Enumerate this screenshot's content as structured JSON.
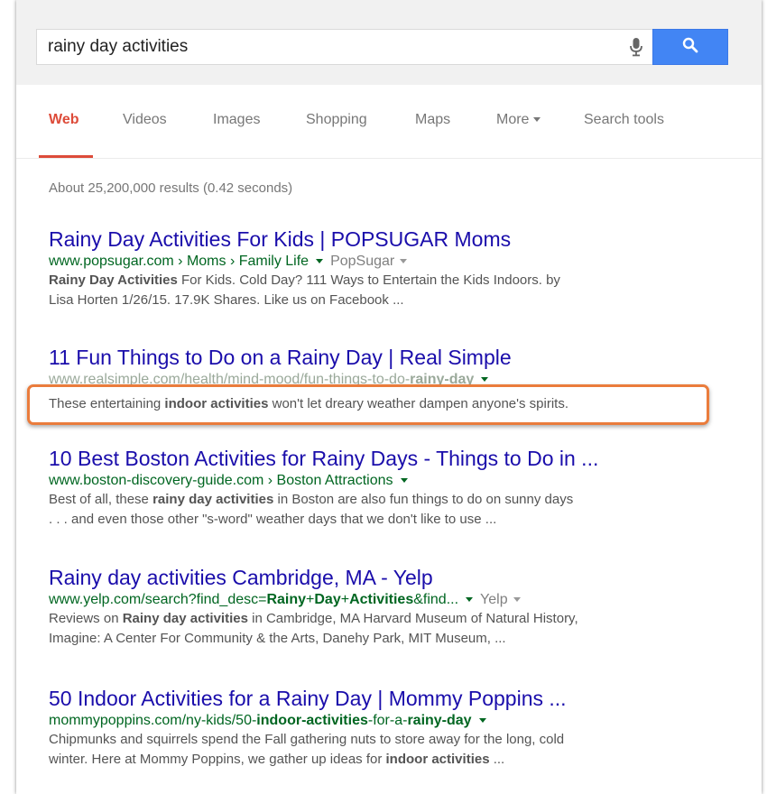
{
  "search": {
    "query": "rainy day activities",
    "mic_icon": "microphone-icon",
    "search_icon": "magnifier-icon",
    "button_color": "#4285f4"
  },
  "tabs": [
    {
      "label": "Web",
      "active": true
    },
    {
      "label": "Videos"
    },
    {
      "label": "Images"
    },
    {
      "label": "Shopping"
    },
    {
      "label": "Maps"
    },
    {
      "label": "More"
    },
    {
      "label": "Search tools"
    }
  ],
  "stats": "About 25,200,000 results (0.42 seconds)",
  "results": [
    {
      "title": "Rainy Day Activities For Kids | POPSUGAR Moms",
      "url": "www.popsugar.com › Moms › Family Life",
      "source": "PopSugar",
      "snippet_line1": [
        "Rainy Day Activities",
        " For Kids. Cold Day? 111 Ways to Entertain the Kids Indoors. by"
      ],
      "snippet_line2": "Lisa Horten 1/26/15. 17.9K Shares. Like us on Facebook ..."
    },
    {
      "title": "11 Fun Things to Do on a Rainy Day | Real Simple",
      "url": "www.realsimple.com/health/mind-mood/fun-things-to-do-",
      "url_bold": "rainy-day",
      "snippet_parts": [
        "These entertaining ",
        "indoor activities",
        " won't let dreary weather dampen anyone's spirits."
      ]
    },
    {
      "title": "10 Best Boston Activities for Rainy Days - Things to Do in ...",
      "url": "www.boston-discovery-guide.com › Boston Attractions",
      "snippet_line1": [
        "Best of all, these ",
        "rainy day activities",
        " in Boston are also fun things to do on sunny days"
      ],
      "snippet_line2": ". . . and even those other \"s-word\" weather days that we don't like to use  ..."
    },
    {
      "title": "Rainy day activities Cambridge, MA - Yelp",
      "url_parts": [
        "www.yelp.com/search?find_desc=",
        "Rainy",
        "+",
        "Day",
        "+",
        "Activities",
        "&find..."
      ],
      "source": "Yelp",
      "snippet_line1": [
        "Reviews on ",
        "Rainy day activities",
        " in Cambridge, MA Harvard Museum of Natural History,"
      ],
      "snippet_line2": "Imagine: A Center For Community & the Arts, Danehy Park, MIT Museum, ..."
    },
    {
      "title": "50 Indoor Activities for a Rainy Day | Mommy Poppins ...",
      "url_parts": [
        "mommypoppins.com/ny-kids/50-",
        "indoor-activities",
        "-for-a-",
        "rainy-day"
      ],
      "snippet_line1": "Chipmunks and squirrels spend the Fall gathering nuts to store away for the long, cold",
      "snippet_line2": [
        "winter. Here at Mommy Poppins, we gather up ideas for ",
        "indoor activities",
        " ..."
      ]
    }
  ],
  "highlight_color": "#ea7c3c"
}
